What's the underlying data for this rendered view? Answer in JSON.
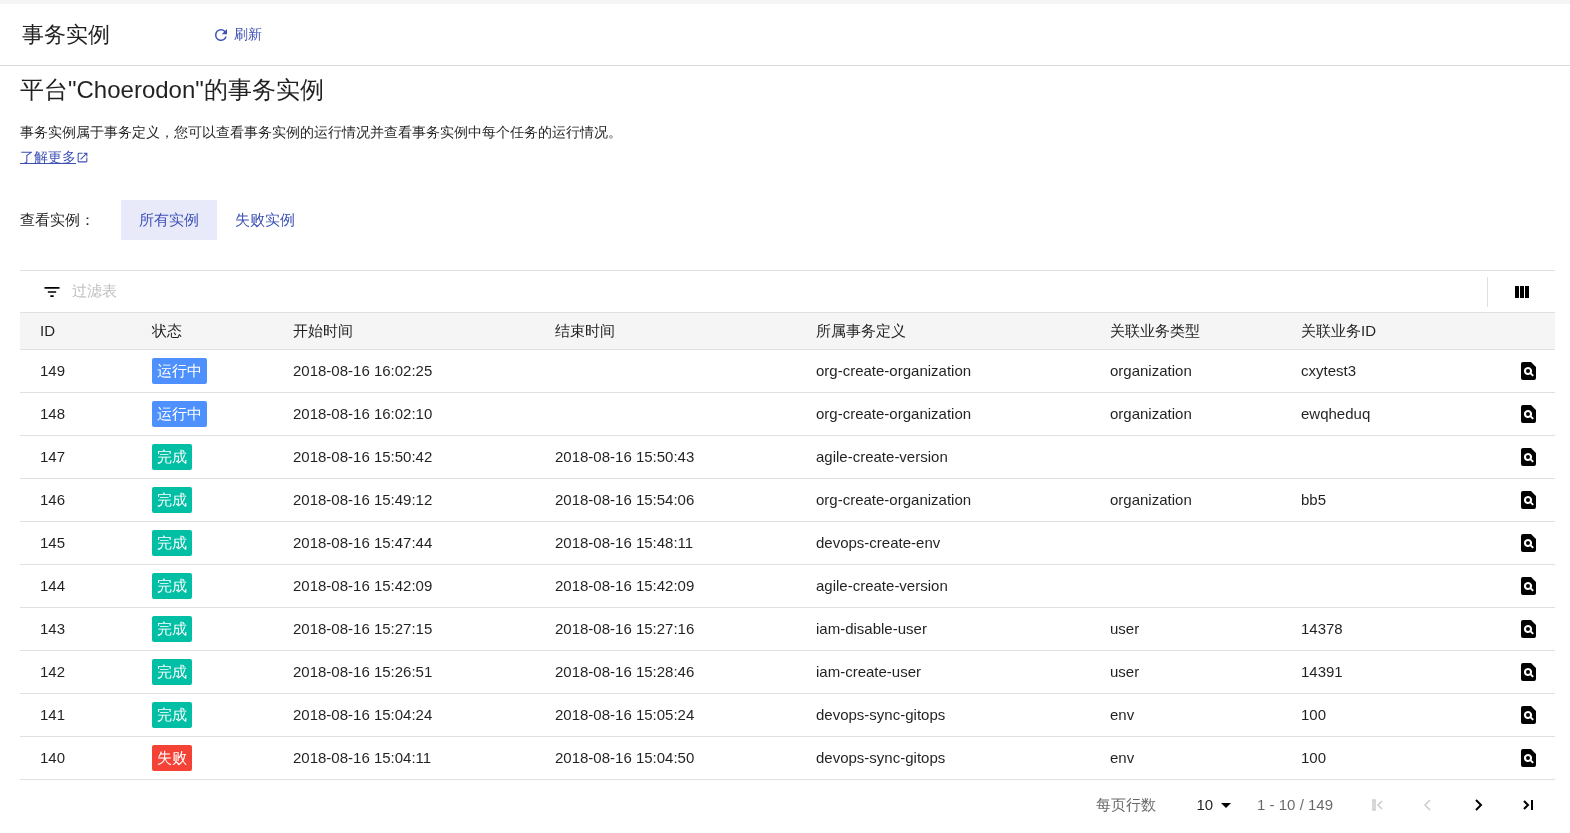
{
  "header": {
    "title": "事务实例",
    "refresh": "刷新"
  },
  "page": {
    "title": "平台\"Choerodon\"的事务实例",
    "description": "事务实例属于事务定义，您可以查看事务实例的运行情况并查看事务实例中每个任务的运行情况。",
    "learn_more": "了解更多"
  },
  "filter_tabs": {
    "label": "查看实例：",
    "tabs": [
      {
        "label": "所有实例",
        "selected": true
      },
      {
        "label": "失败实例",
        "selected": false
      }
    ]
  },
  "table": {
    "filter_placeholder": "过滤表",
    "columns": [
      "ID",
      "状态",
      "开始时间",
      "结束时间",
      "所属事务定义",
      "关联业务类型",
      "关联业务ID"
    ],
    "rows": [
      {
        "id": "149",
        "status": {
          "kind": "running",
          "label": "运行中"
        },
        "start": "2018-08-16 16:02:25",
        "end": "",
        "definition": "org-create-organization",
        "biz_type": "organization",
        "biz_id": "cxytest3"
      },
      {
        "id": "148",
        "status": {
          "kind": "running",
          "label": "运行中"
        },
        "start": "2018-08-16 16:02:10",
        "end": "",
        "definition": "org-create-organization",
        "biz_type": "organization",
        "biz_id": "ewqheduq"
      },
      {
        "id": "147",
        "status": {
          "kind": "done",
          "label": "完成"
        },
        "start": "2018-08-16 15:50:42",
        "end": "2018-08-16 15:50:43",
        "definition": "agile-create-version",
        "biz_type": "",
        "biz_id": ""
      },
      {
        "id": "146",
        "status": {
          "kind": "done",
          "label": "完成"
        },
        "start": "2018-08-16 15:49:12",
        "end": "2018-08-16 15:54:06",
        "definition": "org-create-organization",
        "biz_type": "organization",
        "biz_id": "bb5"
      },
      {
        "id": "145",
        "status": {
          "kind": "done",
          "label": "完成"
        },
        "start": "2018-08-16 15:47:44",
        "end": "2018-08-16 15:48:11",
        "definition": "devops-create-env",
        "biz_type": "",
        "biz_id": ""
      },
      {
        "id": "144",
        "status": {
          "kind": "done",
          "label": "完成"
        },
        "start": "2018-08-16 15:42:09",
        "end": "2018-08-16 15:42:09",
        "definition": "agile-create-version",
        "biz_type": "",
        "biz_id": ""
      },
      {
        "id": "143",
        "status": {
          "kind": "done",
          "label": "完成"
        },
        "start": "2018-08-16 15:27:15",
        "end": "2018-08-16 15:27:16",
        "definition": "iam-disable-user",
        "biz_type": "user",
        "biz_id": "14378"
      },
      {
        "id": "142",
        "status": {
          "kind": "done",
          "label": "完成"
        },
        "start": "2018-08-16 15:26:51",
        "end": "2018-08-16 15:28:46",
        "definition": "iam-create-user",
        "biz_type": "user",
        "biz_id": "14391"
      },
      {
        "id": "141",
        "status": {
          "kind": "done",
          "label": "完成"
        },
        "start": "2018-08-16 15:04:24",
        "end": "2018-08-16 15:05:24",
        "definition": "devops-sync-gitops",
        "biz_type": "env",
        "biz_id": "100"
      },
      {
        "id": "140",
        "status": {
          "kind": "failed",
          "label": "失败"
        },
        "start": "2018-08-16 15:04:11",
        "end": "2018-08-16 15:04:50",
        "definition": "devops-sync-gitops",
        "biz_type": "env",
        "biz_id": "100"
      }
    ]
  },
  "pagination": {
    "rows_label": "每页行数",
    "page_size": "10",
    "range": "1 - 10 / 149",
    "first_disabled": true,
    "prev_disabled": true,
    "next_disabled": false,
    "last_disabled": false
  }
}
